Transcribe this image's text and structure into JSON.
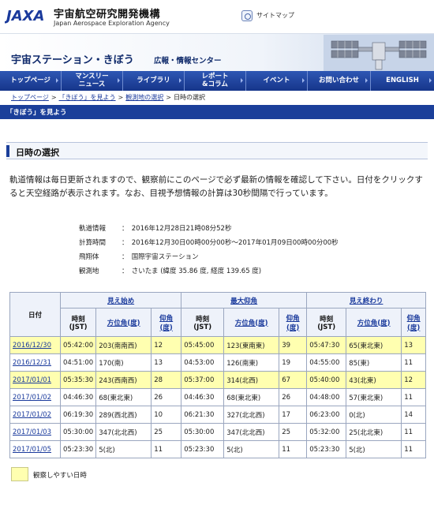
{
  "header": {
    "org_jp": "宇宙航空研究開発機構",
    "org_en": "Japan Aerospace Exploration Agency",
    "logo_text": "JAXA",
    "sitemap": "サイトマップ"
  },
  "banner": {
    "title": "宇宙ステーション・きぼう",
    "subtitle": "広報・情報センター"
  },
  "nav": {
    "items": [
      {
        "label": "トップページ"
      },
      {
        "label": "マンスリー\nニュース"
      },
      {
        "label": "ライブラリ"
      },
      {
        "label": "レポート\n&コラム"
      },
      {
        "label": "イベント"
      },
      {
        "label": "お問い合わせ"
      },
      {
        "label": "ENGLISH"
      }
    ]
  },
  "breadcrumb": {
    "items": [
      "トップページ",
      "「きぼう」を見よう",
      "観測地の選択"
    ],
    "current": "日時の選択",
    "separator": ">"
  },
  "section_label": "「きぼう」を見よう",
  "page_title": "日時の選択",
  "intro": "軌道情報は毎日更新されますので、観察前にこのページで必ず最新の情報を確認して下さい。日付をクリックすると天空経路が表示されます。なお、目視予想情報の計算は30秒間隔で行っています。",
  "info": [
    {
      "label": "軌道情報",
      "value": "：　2016年12月28日21時08分52秒"
    },
    {
      "label": "計算時間",
      "value": "：　2016年12月30日00時00分00秒～2017年01月09日00時00分00秒"
    },
    {
      "label": "飛翔体",
      "value": "：　国際宇宙ステーション"
    },
    {
      "label": "観測地",
      "value": "：　さいたま (緯度 35.86 度, 経度 139.65 度)"
    }
  ],
  "table": {
    "date_header": "日付",
    "groups": [
      "見え始め",
      "最大仰角",
      "見え終わり"
    ],
    "sub": {
      "time": "時刻\n(JST)",
      "azimuth": "方位角(度)",
      "elevation": "仰角\n(度)"
    },
    "rows": [
      {
        "date": "2016/12/30",
        "hl": true,
        "c": [
          "05:42:00",
          "203(南南西)",
          "12",
          "05:45:00",
          "123(東南東)",
          "39",
          "05:47:30",
          "65(東北東)",
          "13"
        ]
      },
      {
        "date": "2016/12/31",
        "hl": false,
        "c": [
          "04:51:00",
          "170(南)",
          "13",
          "04:53:00",
          "126(南東)",
          "19",
          "04:55:00",
          "85(東)",
          "11"
        ]
      },
      {
        "date": "2017/01/01",
        "hl": true,
        "c": [
          "05:35:30",
          "243(西南西)",
          "28",
          "05:37:00",
          "314(北西)",
          "67",
          "05:40:00",
          "43(北東)",
          "12"
        ]
      },
      {
        "date": "2017/01/02",
        "hl": false,
        "c": [
          "04:46:30",
          "68(東北東)",
          "26",
          "04:46:30",
          "68(東北東)",
          "26",
          "04:48:00",
          "57(東北東)",
          "11"
        ]
      },
      {
        "date": "2017/01/02",
        "hl": false,
        "c": [
          "06:19:30",
          "289(西北西)",
          "10",
          "06:21:30",
          "327(北北西)",
          "17",
          "06:23:00",
          "0(北)",
          "14"
        ]
      },
      {
        "date": "2017/01/03",
        "hl": false,
        "c": [
          "05:30:00",
          "347(北北西)",
          "25",
          "05:30:00",
          "347(北北西)",
          "25",
          "05:32:00",
          "25(北北東)",
          "11"
        ]
      },
      {
        "date": "2017/01/05",
        "hl": false,
        "c": [
          "05:23:30",
          "5(北)",
          "11",
          "05:23:30",
          "5(北)",
          "11",
          "05:23:30",
          "5(北)",
          "11"
        ]
      }
    ]
  },
  "legend": "観察しやすい日時",
  "colors": {
    "highlight": "#ffffb0",
    "nav": "#1b3f9a",
    "link": "#1a3a9c"
  }
}
